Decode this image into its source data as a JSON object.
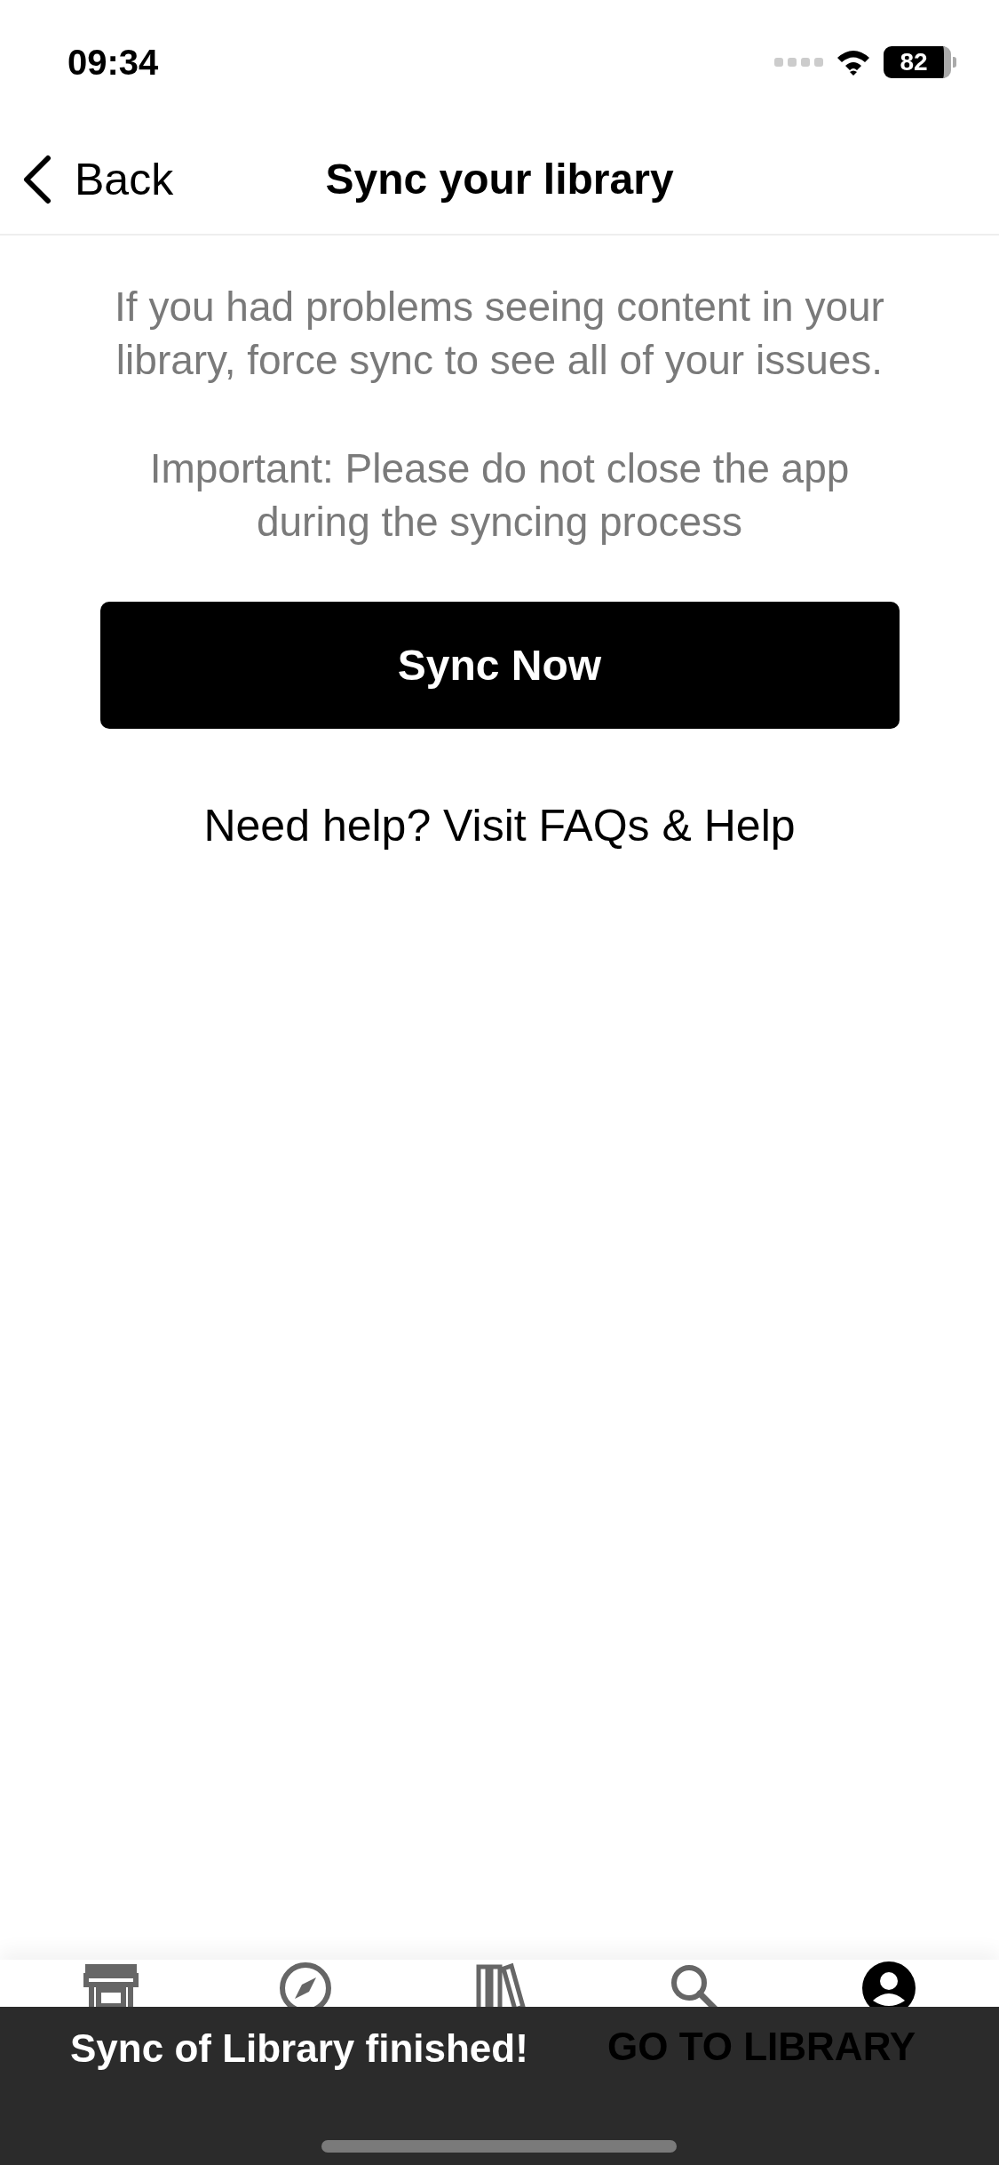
{
  "status_bar": {
    "time": "09:34",
    "battery": "82"
  },
  "nav": {
    "back": "Back",
    "title": "Sync your library"
  },
  "content": {
    "paragraphs": [
      "If you had problems seeing content in your library, force sync to see all of your issues.",
      "Important: Please do not close the app during the syncing process"
    ],
    "button": "Sync Now",
    "help": "Need help? Visit FAQs & Help"
  },
  "tabs": [
    {
      "kind": "store",
      "selected": false
    },
    {
      "kind": "compass",
      "selected": false
    },
    {
      "kind": "books",
      "selected": false
    },
    {
      "kind": "search",
      "selected": false
    },
    {
      "kind": "profile",
      "selected": true
    }
  ],
  "snackbar": {
    "message": "Sync of Library finished!",
    "action": "GO TO LIBRARY"
  }
}
